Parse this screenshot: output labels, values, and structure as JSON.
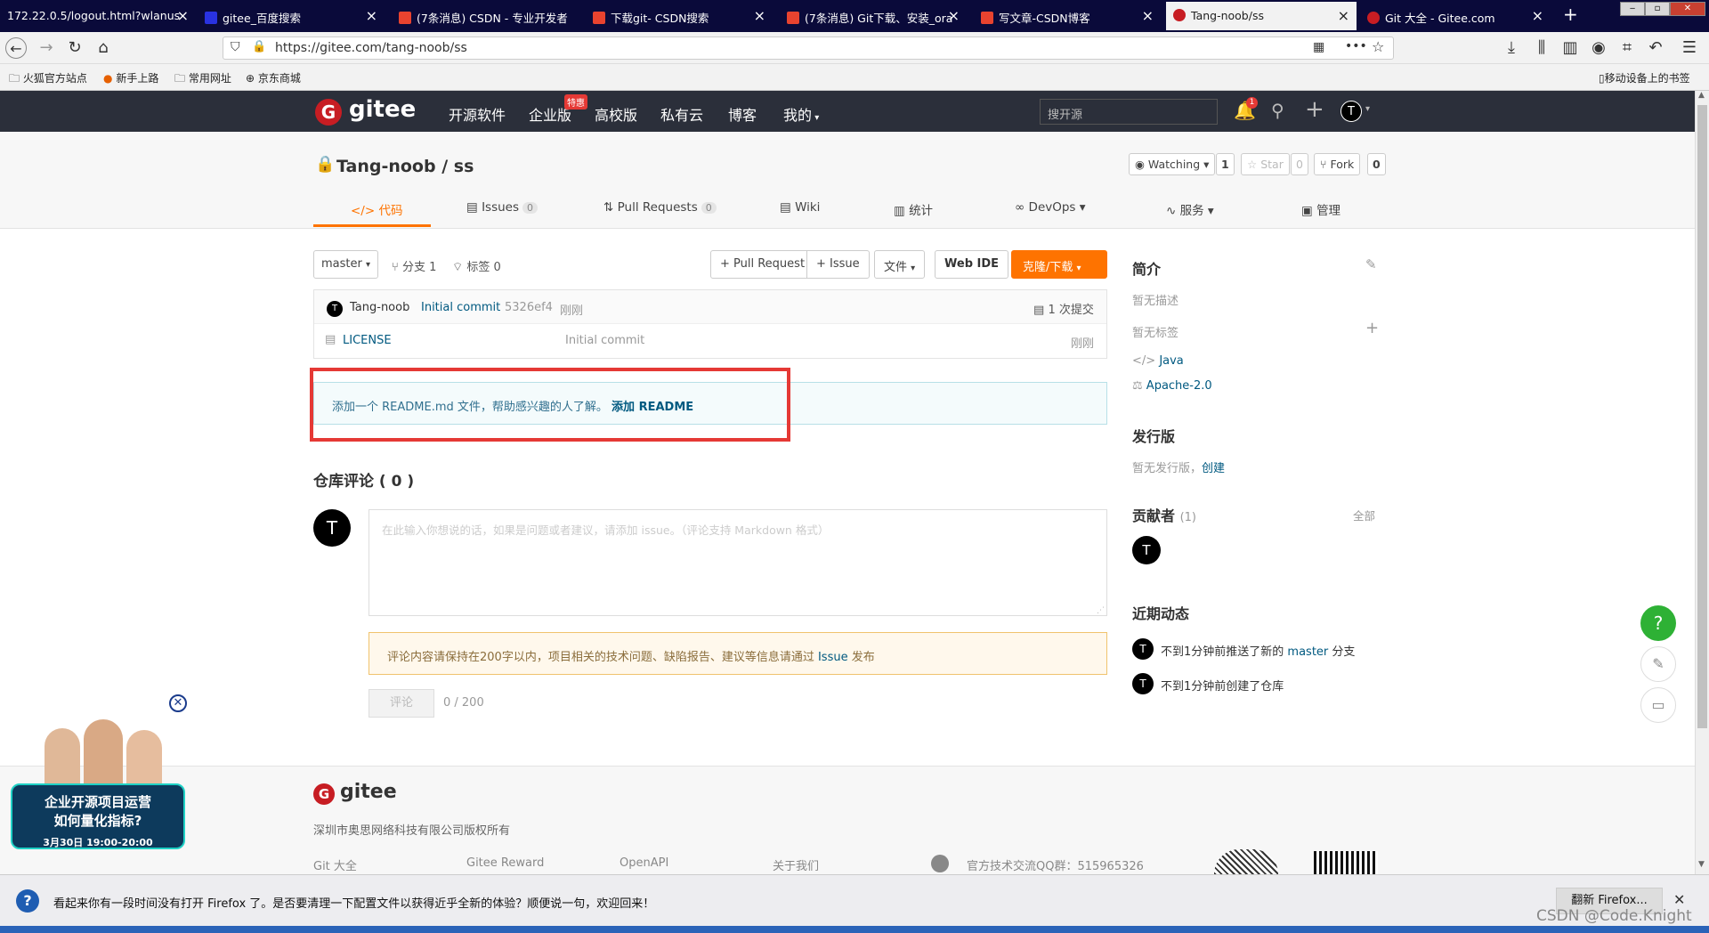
{
  "browser": {
    "tabs": [
      {
        "title": "172.22.0.5/logout.html?wlanus"
      },
      {
        "title": "gitee_百度搜索"
      },
      {
        "title": "(7条消息) CSDN - 专业开发者"
      },
      {
        "title": "下载git- CSDN搜索"
      },
      {
        "title": "(7条消息) Git下载、安装_ora"
      },
      {
        "title": "写文章-CSDN博客"
      },
      {
        "title": "Tang-noob/ss"
      },
      {
        "title": "Git 大全 - Gitee.com"
      }
    ],
    "new_tab": "+",
    "url": "https://gitee.com/tang-noob/ss",
    "bookmarks": [
      "火狐官方站点",
      "新手上路",
      "常用网址",
      "京东商城"
    ],
    "mobile_bookmarks": "移动设备上的书签"
  },
  "gitee": {
    "logo": "gitee",
    "nav": [
      "开源软件",
      "企业版",
      "高校版",
      "私有云",
      "博客",
      "我的"
    ],
    "nav_badge": "特惠",
    "search_placeholder": "搜开源",
    "notification_count": "1",
    "user_initial": "T"
  },
  "repo": {
    "owner": "Tang-noob",
    "sep": " / ",
    "name": "ss",
    "watch_label": "Watching",
    "watch_count": "1",
    "star_label": "Star",
    "star_count": "0",
    "fork_label": "Fork",
    "fork_count": "0",
    "tabs": [
      {
        "label": "代码",
        "count": ""
      },
      {
        "label": "Issues",
        "count": "0"
      },
      {
        "label": "Pull Requests",
        "count": "0"
      },
      {
        "label": "Wiki",
        "count": ""
      },
      {
        "label": "统计",
        "count": ""
      },
      {
        "label": "DevOps",
        "count": ""
      },
      {
        "label": "服务",
        "count": ""
      },
      {
        "label": "管理",
        "count": ""
      }
    ],
    "branch": "master",
    "branches": "分支 1",
    "tags": "标签 0",
    "btn_pr": "+ Pull Request",
    "btn_issue": "+ Issue",
    "btn_file": "文件",
    "btn_webide": "Web IDE",
    "btn_clone": "克隆/下载",
    "commit": {
      "author": "Tang-noob",
      "message": "Initial commit",
      "hash": "5326ef4",
      "time": "刚刚",
      "count": "1 次提交"
    },
    "files": [
      {
        "name": "LICENSE",
        "message": "Initial commit",
        "time": "刚刚"
      }
    ],
    "readme_notice": "添加一个 README.md 文件，帮助感兴趣的人了解。",
    "readme_link": "添加 README",
    "comments_title": "仓库评论 ( 0 )",
    "comment_placeholder": "在此输入你想说的话，如果是问题或者建议，请添加 issue。（评论支持 Markdown 格式）",
    "comment_warning_pre": "评论内容请保持在200字以内，项目相关的技术问题、缺陷报告、建议等信息请通过",
    "comment_warning_link": "Issue",
    "comment_warning_post": "发布",
    "comment_btn": "评论",
    "comment_counter": "0 / 200"
  },
  "sidebar": {
    "intro_title": "简介",
    "no_desc": "暂无描述",
    "no_tags": "暂无标签",
    "language": "Java",
    "license": "Apache-2.0",
    "release_title": "发行版",
    "no_release": "暂无发行版，",
    "create": "创建",
    "contributors_title": "贡献者",
    "contributors_count": "(1)",
    "all": "全部",
    "activity_title": "近期动态",
    "activity": [
      {
        "pre": "不到1分钟前推送了新的",
        "link": "master",
        "post": "分支"
      },
      {
        "pre": "不到1分钟前创建了仓库",
        "link": "",
        "post": ""
      }
    ]
  },
  "float": {
    "help": "?"
  },
  "ad": {
    "line1": "企业开源项目运营",
    "line2": "如何量化指标?",
    "time": "3月30日 19:00-20:00"
  },
  "footer": {
    "logo": "gitee",
    "company": "深圳市奥思网络科技有限公司版权所有",
    "links": [
      "Git 大全",
      "Gitee Reward",
      "OpenAPI",
      "关于我们"
    ],
    "qq": "官方技术交流QQ群：515965326"
  },
  "notification": {
    "text": "看起来你有一段时间没有打开 Firefox 了。是否要清理一下配置文件以获得近乎全新的体验？顺便说一句，欢迎回来！",
    "button": "翻新 Firefox...",
    "watermark": "CSDN @Code.Knight"
  },
  "colors": {
    "brand": "#c71d23",
    "header": "#2b2f3a",
    "orange": "#fe7300",
    "link": "#005980",
    "highlight": "#e53935"
  }
}
